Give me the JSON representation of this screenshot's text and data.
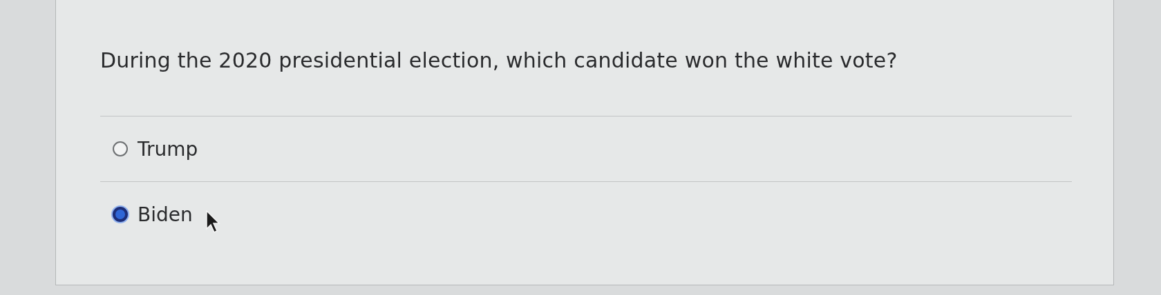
{
  "question": "During the 2020 presidential election, which candidate won the white vote?",
  "options": [
    {
      "label": "Trump",
      "selected": false
    },
    {
      "label": "Biden",
      "selected": true
    }
  ]
}
